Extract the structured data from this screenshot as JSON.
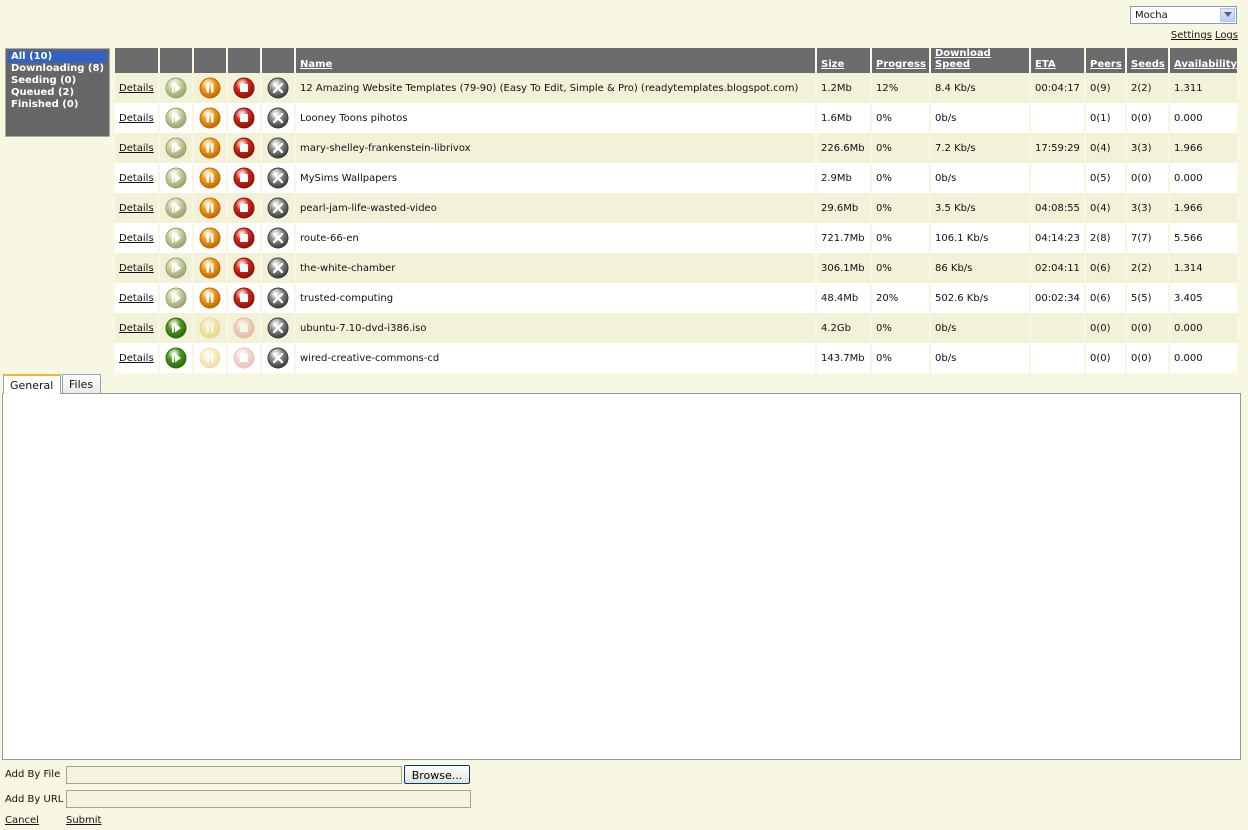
{
  "theme": {
    "selected": "Mocha"
  },
  "links": {
    "settings": "Settings",
    "logs": "Logs"
  },
  "filters": [
    {
      "label": "All (10)",
      "selected": true
    },
    {
      "label": "Downloading (8)",
      "selected": false
    },
    {
      "label": "Seeding (0)",
      "selected": false
    },
    {
      "label": "Queued (2)",
      "selected": false
    },
    {
      "label": "Finished (0)",
      "selected": false
    }
  ],
  "columns": {
    "name": "Name",
    "size": "Size",
    "progress": "Progress",
    "speed": "Download Speed",
    "eta": "ETA",
    "peers": "Peers",
    "seeds": "Seeds",
    "availability": "Availability"
  },
  "details_label": "Details",
  "torrents": [
    {
      "name": "12 Amazing Website Templates (79-90) (Easy To Edit, Simple & Pro) (readytemplates.blogspot.com)",
      "size": "1.2Mb",
      "progress": "12%",
      "speed": "8.4 Kb/s",
      "eta": "00:04:17",
      "peers": "0(9)",
      "seeds": "2(2)",
      "availability": "1.311",
      "state": "downloading"
    },
    {
      "name": "Looney Toons pihotos",
      "size": "1.6Mb",
      "progress": "0%",
      "speed": "0b/s",
      "eta": "",
      "peers": "0(1)",
      "seeds": "0(0)",
      "availability": "0.000",
      "state": "downloading"
    },
    {
      "name": "mary-shelley-frankenstein-librivox",
      "size": "226.6Mb",
      "progress": "0%",
      "speed": "7.2 Kb/s",
      "eta": "17:59:29",
      "peers": "0(4)",
      "seeds": "3(3)",
      "availability": "1.966",
      "state": "downloading"
    },
    {
      "name": "MySims Wallpapers",
      "size": "2.9Mb",
      "progress": "0%",
      "speed": "0b/s",
      "eta": "",
      "peers": "0(5)",
      "seeds": "0(0)",
      "availability": "0.000",
      "state": "downloading"
    },
    {
      "name": "pearl-jam-life-wasted-video",
      "size": "29.6Mb",
      "progress": "0%",
      "speed": "3.5 Kb/s",
      "eta": "04:08:55",
      "peers": "0(4)",
      "seeds": "3(3)",
      "availability": "1.966",
      "state": "downloading"
    },
    {
      "name": "route-66-en",
      "size": "721.7Mb",
      "progress": "0%",
      "speed": "106.1 Kb/s",
      "eta": "04:14:23",
      "peers": "2(8)",
      "seeds": "7(7)",
      "availability": "5.566",
      "state": "downloading"
    },
    {
      "name": "the-white-chamber",
      "size": "306.1Mb",
      "progress": "0%",
      "speed": "86 Kb/s",
      "eta": "02:04:11",
      "peers": "0(6)",
      "seeds": "2(2)",
      "availability": "1.314",
      "state": "downloading"
    },
    {
      "name": "trusted-computing",
      "size": "48.4Mb",
      "progress": "20%",
      "speed": "502.6 Kb/s",
      "eta": "00:02:34",
      "peers": "0(6)",
      "seeds": "5(5)",
      "availability": "3.405",
      "state": "downloading"
    },
    {
      "name": "ubuntu-7.10-dvd-i386.iso",
      "size": "4.2Gb",
      "progress": "0%",
      "speed": "0b/s",
      "eta": "",
      "peers": "0(0)",
      "seeds": "0(0)",
      "availability": "0.000",
      "state": "queued"
    },
    {
      "name": "wired-creative-commons-cd",
      "size": "143.7Mb",
      "progress": "0%",
      "speed": "0b/s",
      "eta": "",
      "peers": "0(0)",
      "seeds": "0(0)",
      "availability": "0.000",
      "state": "queued"
    }
  ],
  "tabs": [
    {
      "label": "General",
      "active": true
    },
    {
      "label": "Files",
      "active": false
    }
  ],
  "add": {
    "by_file_label": "Add By File",
    "by_url_label": "Add By URL",
    "browse_label": "Browse...",
    "cancel_label": "Cancel",
    "submit_label": "Submit"
  },
  "icons": {
    "start": "play-icon",
    "pause": "pause-icon",
    "stop": "stop-icon",
    "remove": "remove-icon"
  },
  "colors": {
    "background": "#f8f7e1",
    "header": "#6b6b6b",
    "filter_bg": "#666666",
    "filter_selected": "#3162c4",
    "start_active": "#4a9a1e",
    "pause_active": "#f29a18",
    "stop_active": "#d4281c",
    "remove": "#6a6a6a",
    "tab_accent": "#f7b32e"
  }
}
